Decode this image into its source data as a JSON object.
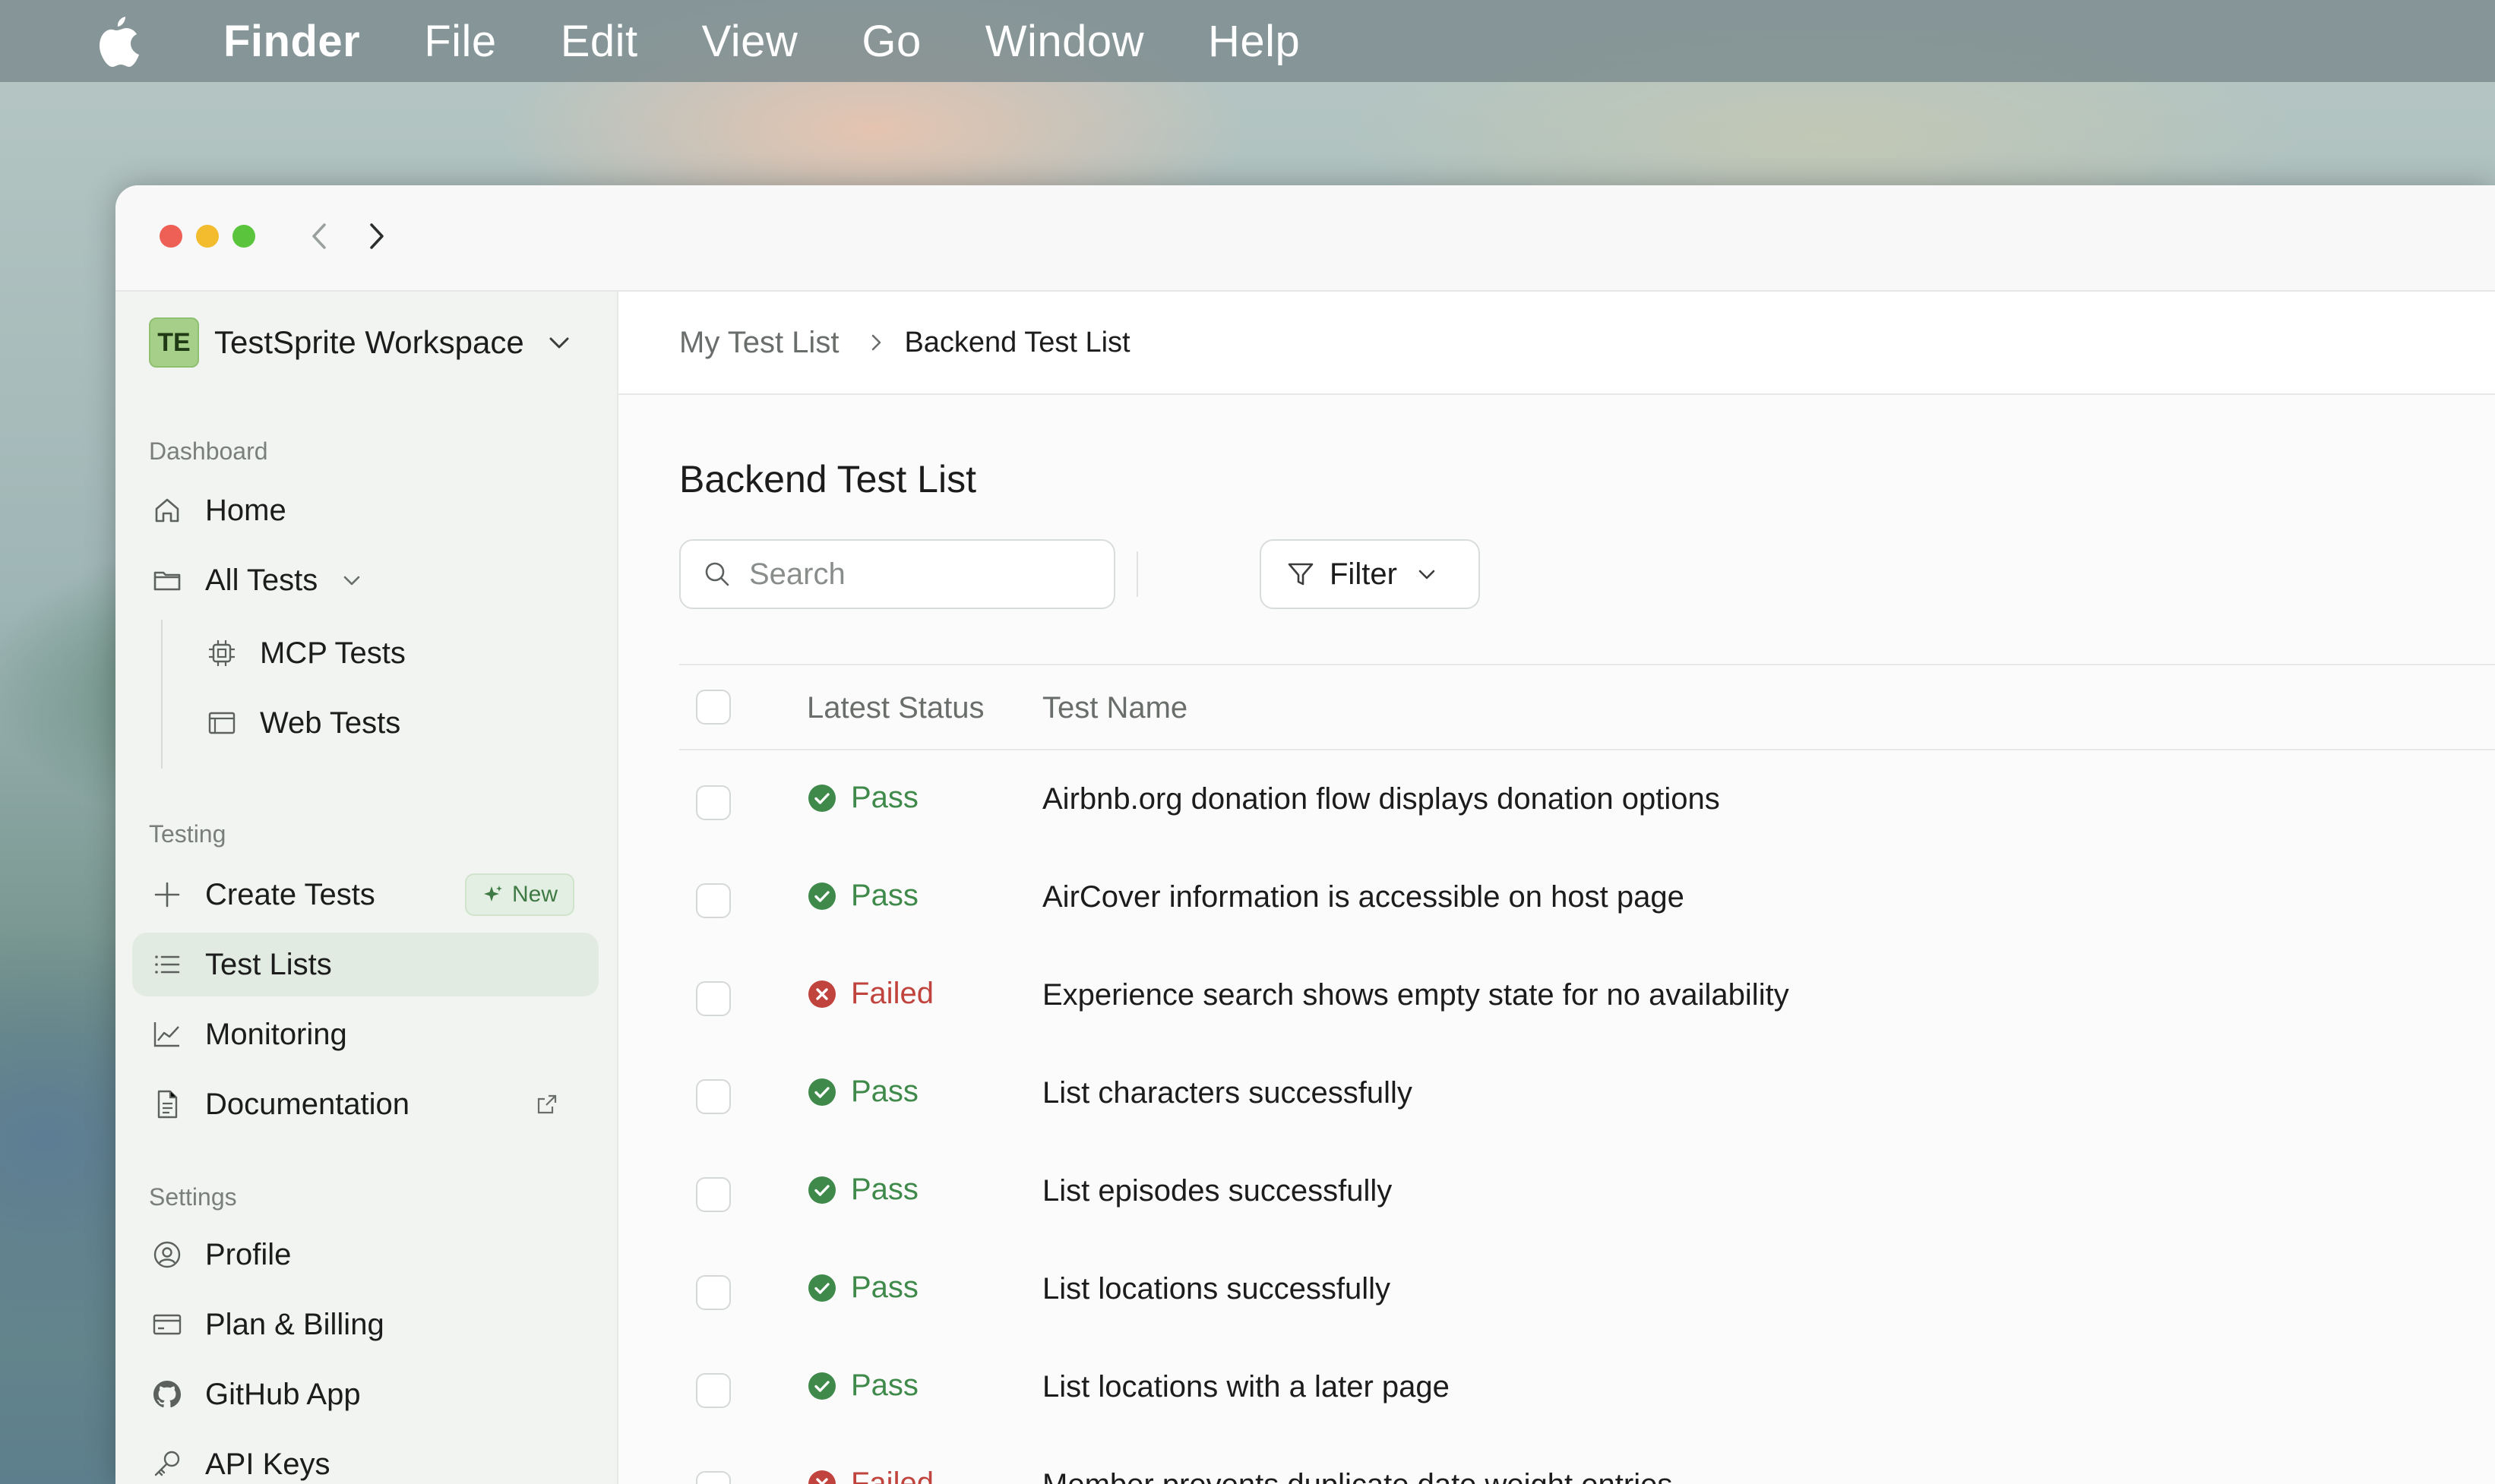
{
  "menubar": {
    "app_name": "Finder",
    "items": [
      "File",
      "Edit",
      "View",
      "Go",
      "Window",
      "Help"
    ]
  },
  "window": {
    "nav": {
      "back_icon": "chevron-left-icon",
      "forward_icon": "chevron-right-icon"
    }
  },
  "sidebar": {
    "workspace": {
      "avatar_text": "TE",
      "name": "TestSprite Workspace"
    },
    "sections": {
      "dashboard": "Dashboard",
      "testing": "Testing",
      "settings": "Settings"
    },
    "items": {
      "home": "Home",
      "all_tests": "All Tests",
      "mcp_tests": "MCP Tests",
      "web_tests": "Web Tests",
      "create_tests": "Create Tests",
      "create_tests_badge": "New",
      "test_lists": "Test Lists",
      "monitoring": "Monitoring",
      "documentation": "Documentation",
      "profile": "Profile",
      "plan_billing": "Plan & Billing",
      "github_app": "GitHub App",
      "api_keys": "API Keys"
    }
  },
  "breadcrumb": {
    "parent": "My Test List",
    "current": "Backend Test List"
  },
  "main": {
    "title": "Backend Test List",
    "search_placeholder": "Search",
    "filter_label": "Filter"
  },
  "table": {
    "columns": {
      "status": "Latest Status",
      "name": "Test Name"
    },
    "rows": [
      {
        "status": "Pass",
        "name": "Airbnb.org donation flow displays donation options"
      },
      {
        "status": "Pass",
        "name": "AirCover information is accessible on host page"
      },
      {
        "status": "Failed",
        "name": "Experience search shows empty state for no availability"
      },
      {
        "status": "Pass",
        "name": "List characters successfully"
      },
      {
        "status": "Pass",
        "name": "List episodes successfully"
      },
      {
        "status": "Pass",
        "name": "List locations successfully"
      },
      {
        "status": "Pass",
        "name": "List locations with a later page"
      },
      {
        "status": "Failed",
        "name": "Member prevents duplicate date weight entries"
      }
    ]
  },
  "colors": {
    "pass": "#3f8a4b",
    "fail": "#c0433d",
    "active_bg": "#e1ebe2",
    "accent_green": "#a6cf8a"
  }
}
